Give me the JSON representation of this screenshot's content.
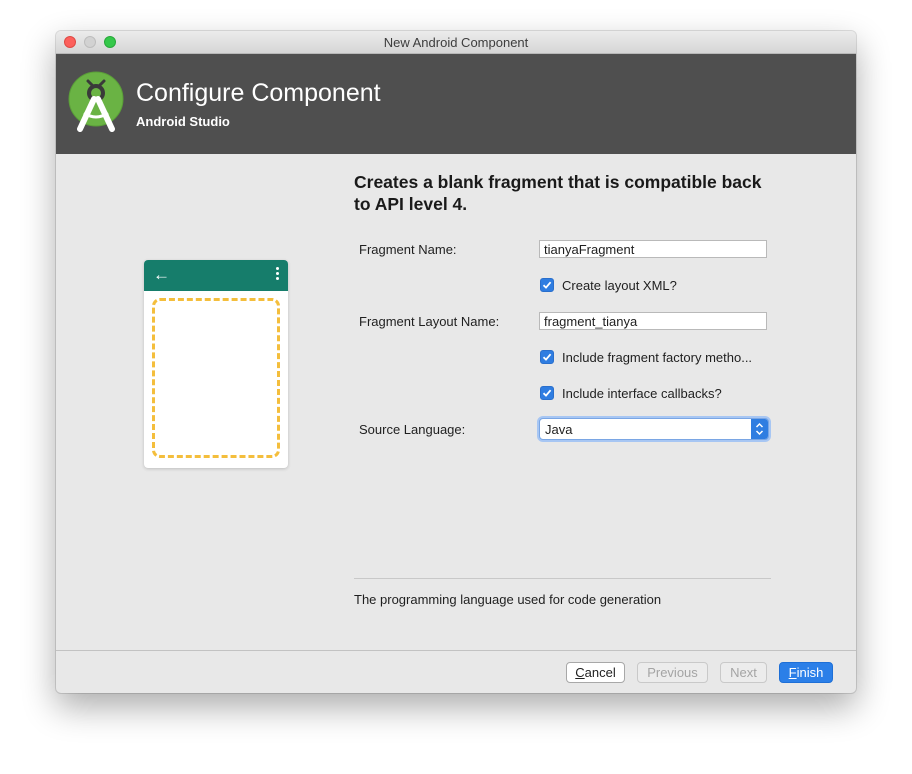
{
  "window": {
    "title": "New Android Component"
  },
  "header": {
    "title": "Configure Component",
    "subtitle": "Android Studio",
    "logo_icon": "android-studio-logo"
  },
  "preview": {
    "back_icon": "←",
    "menu_icon": "overflow-menu-icon",
    "toolbar_color": "#167d6b",
    "fragment_outline_color": "#f4be3c"
  },
  "form": {
    "description": "Creates a blank fragment that is compatible back to API level 4.",
    "fragment_name_label": "Fragment Name:",
    "fragment_name_value": "tianyaFragment",
    "create_layout_label": "Create layout XML?",
    "create_layout_checked": true,
    "layout_name_label": "Fragment Layout Name:",
    "layout_name_value": "fragment_tianya",
    "factory_methods_label": "Include fragment factory metho...",
    "factory_methods_checked": true,
    "interface_callbacks_label": "Include interface callbacks?",
    "interface_callbacks_checked": true,
    "source_language_label": "Source Language:",
    "source_language_value": "Java"
  },
  "help_text": "The programming language used for code generation",
  "buttons": {
    "cancel_mnemonic": "C",
    "cancel_rest": "ancel",
    "previous": "Previous",
    "next": "Next",
    "finish_mnemonic": "F",
    "finish_rest": "inish"
  },
  "colors": {
    "accent": "#2f7de1",
    "header_bg": "#4f4f4f",
    "window_bg": "#e8e8e8"
  }
}
